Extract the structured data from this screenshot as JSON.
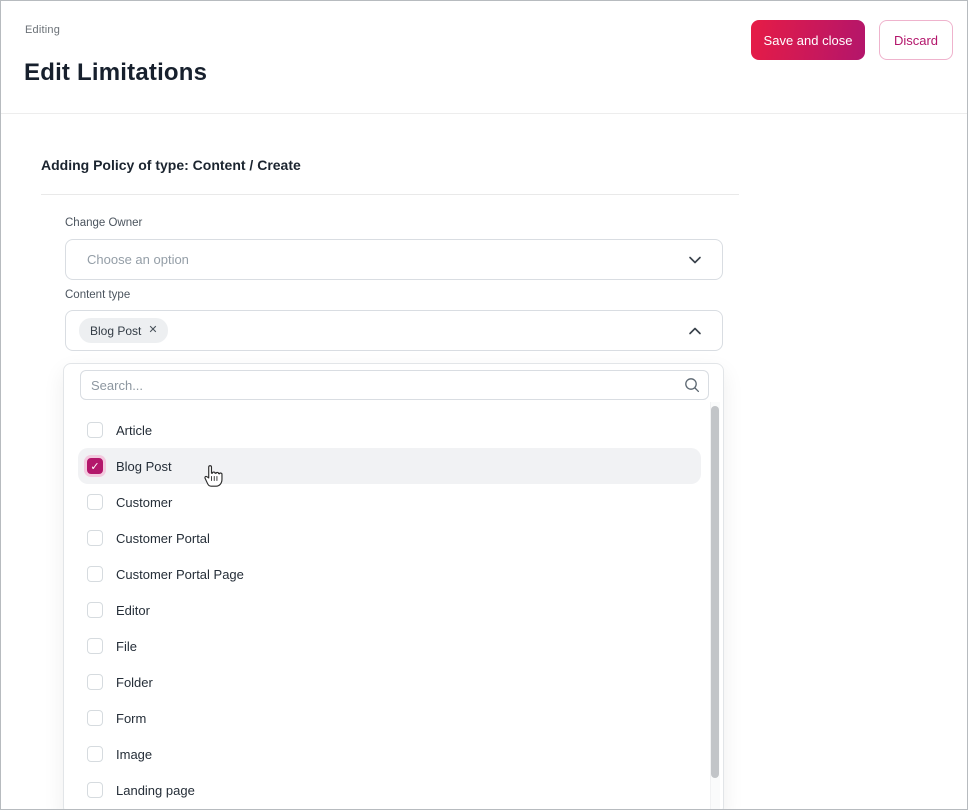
{
  "header": {
    "breadcrumb": "Editing",
    "title": "Edit Limitations",
    "save_label": "Save and close",
    "discard_label": "Discard"
  },
  "form": {
    "section_title": "Adding Policy of type: Content / Create",
    "change_owner": {
      "label": "Change Owner",
      "placeholder": "Choose an option"
    },
    "content_type": {
      "label": "Content type",
      "selected_chip": "Blog Post"
    }
  },
  "dropdown": {
    "search_placeholder": "Search...",
    "options": [
      {
        "label": "Article",
        "checked": false,
        "highlighted": false
      },
      {
        "label": "Blog Post",
        "checked": true,
        "highlighted": true
      },
      {
        "label": "Customer",
        "checked": false,
        "highlighted": false
      },
      {
        "label": "Customer Portal",
        "checked": false,
        "highlighted": false
      },
      {
        "label": "Customer Portal Page",
        "checked": false,
        "highlighted": false
      },
      {
        "label": "Editor",
        "checked": false,
        "highlighted": false
      },
      {
        "label": "File",
        "checked": false,
        "highlighted": false
      },
      {
        "label": "Folder",
        "checked": false,
        "highlighted": false
      },
      {
        "label": "Form",
        "checked": false,
        "highlighted": false
      },
      {
        "label": "Image",
        "checked": false,
        "highlighted": false
      },
      {
        "label": "Landing page",
        "checked": false,
        "highlighted": false
      }
    ]
  },
  "icons": {
    "chip_remove": "✕",
    "checkmark": "✓",
    "chevron_down": "chevron-down",
    "chevron_up": "chevron-up",
    "search": "magnifier",
    "cursor": "hand-pointer"
  },
  "colors": {
    "accent": "#b3156b",
    "save_gradient_start": "#e61c46",
    "save_gradient_end": "#b3156b",
    "checkbox_checked": "#b3176b",
    "checkbox_halo": "#f3cadf",
    "row_highlight": "#f1f2f4",
    "border": "#d9dde2",
    "title_text": "#17202d"
  }
}
